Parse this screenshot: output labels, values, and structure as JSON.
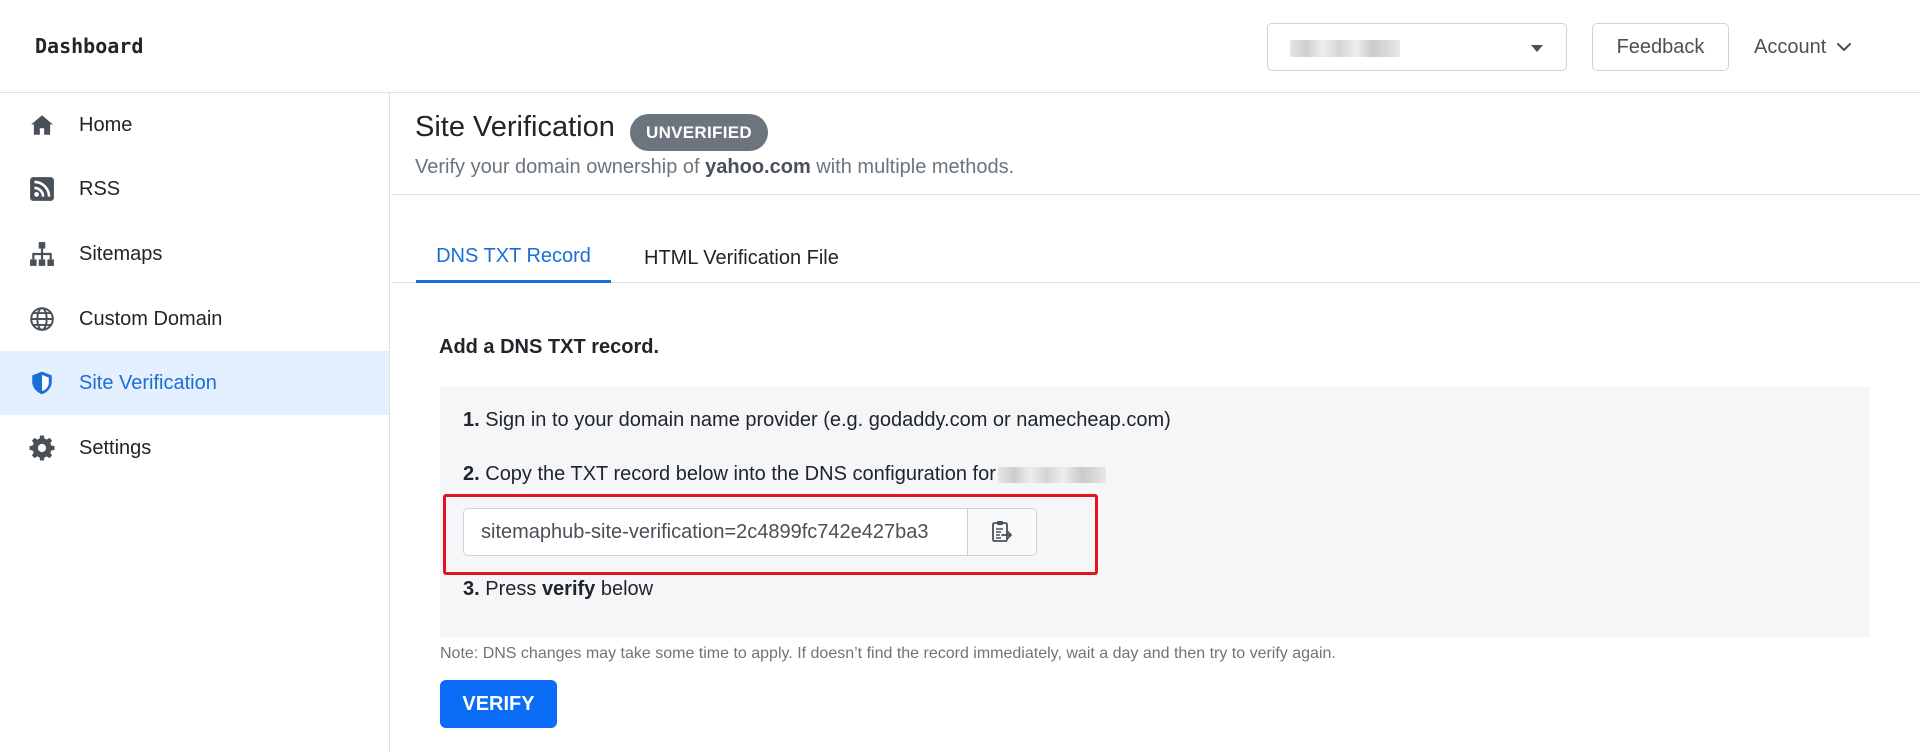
{
  "header": {
    "brand": "Dashboard",
    "site_selector": {
      "selected": "",
      "caret_icon": "caret-down-icon"
    },
    "feedback_label": "Feedback",
    "account_label": "Account",
    "account_icon": "chevron-down-icon"
  },
  "sidebar": {
    "items": [
      {
        "label": "Home",
        "icon": "home-icon",
        "active": false
      },
      {
        "label": "RSS",
        "icon": "rss-icon",
        "active": false
      },
      {
        "label": "Sitemaps",
        "icon": "sitemap-icon",
        "active": false
      },
      {
        "label": "Custom Domain",
        "icon": "globe-icon",
        "active": false
      },
      {
        "label": "Site Verification",
        "icon": "shield-icon",
        "active": true
      },
      {
        "label": "Settings",
        "icon": "gear-icon",
        "active": false
      }
    ]
  },
  "main": {
    "title": "Site Verification",
    "badge": "UNVERIFIED",
    "subtitle_prefix": "Verify your domain ownership of ",
    "subtitle_domain": "yahoo.com",
    "subtitle_suffix": " with multiple methods.",
    "tabs": [
      {
        "label": "DNS TXT Record",
        "active": true
      },
      {
        "label": "HTML Verification File",
        "active": false
      }
    ],
    "section_heading": "Add a DNS TXT record.",
    "steps": {
      "step1_number": "1.",
      "step1_text": " Sign in to your domain name provider (e.g. godaddy.com or namecheap.com)",
      "step2_number": "2.",
      "step2_text": " Copy the TXT record below into the DNS configuration for",
      "step3_number": "3.",
      "step3_pre": " Press ",
      "step3_bold": "verify",
      "step3_post": " below"
    },
    "txt_record_value": "sitemaphub-site-verification=2c4899fc742e427ba3",
    "copy_icon": "clipboard-copy-icon",
    "note": "Note: DNS changes may take some time to apply. If doesn’t find the record immediately, wait a day and then try to verify again.",
    "verify_label": "VERIFY"
  },
  "colors": {
    "accent": "#1a6fd6",
    "active_bg": "#e4efff",
    "badge_bg": "#6c757d",
    "verify_bg": "#0b6cf5",
    "highlight_border": "#e3141c",
    "steps_bg": "#f5f6f8"
  }
}
